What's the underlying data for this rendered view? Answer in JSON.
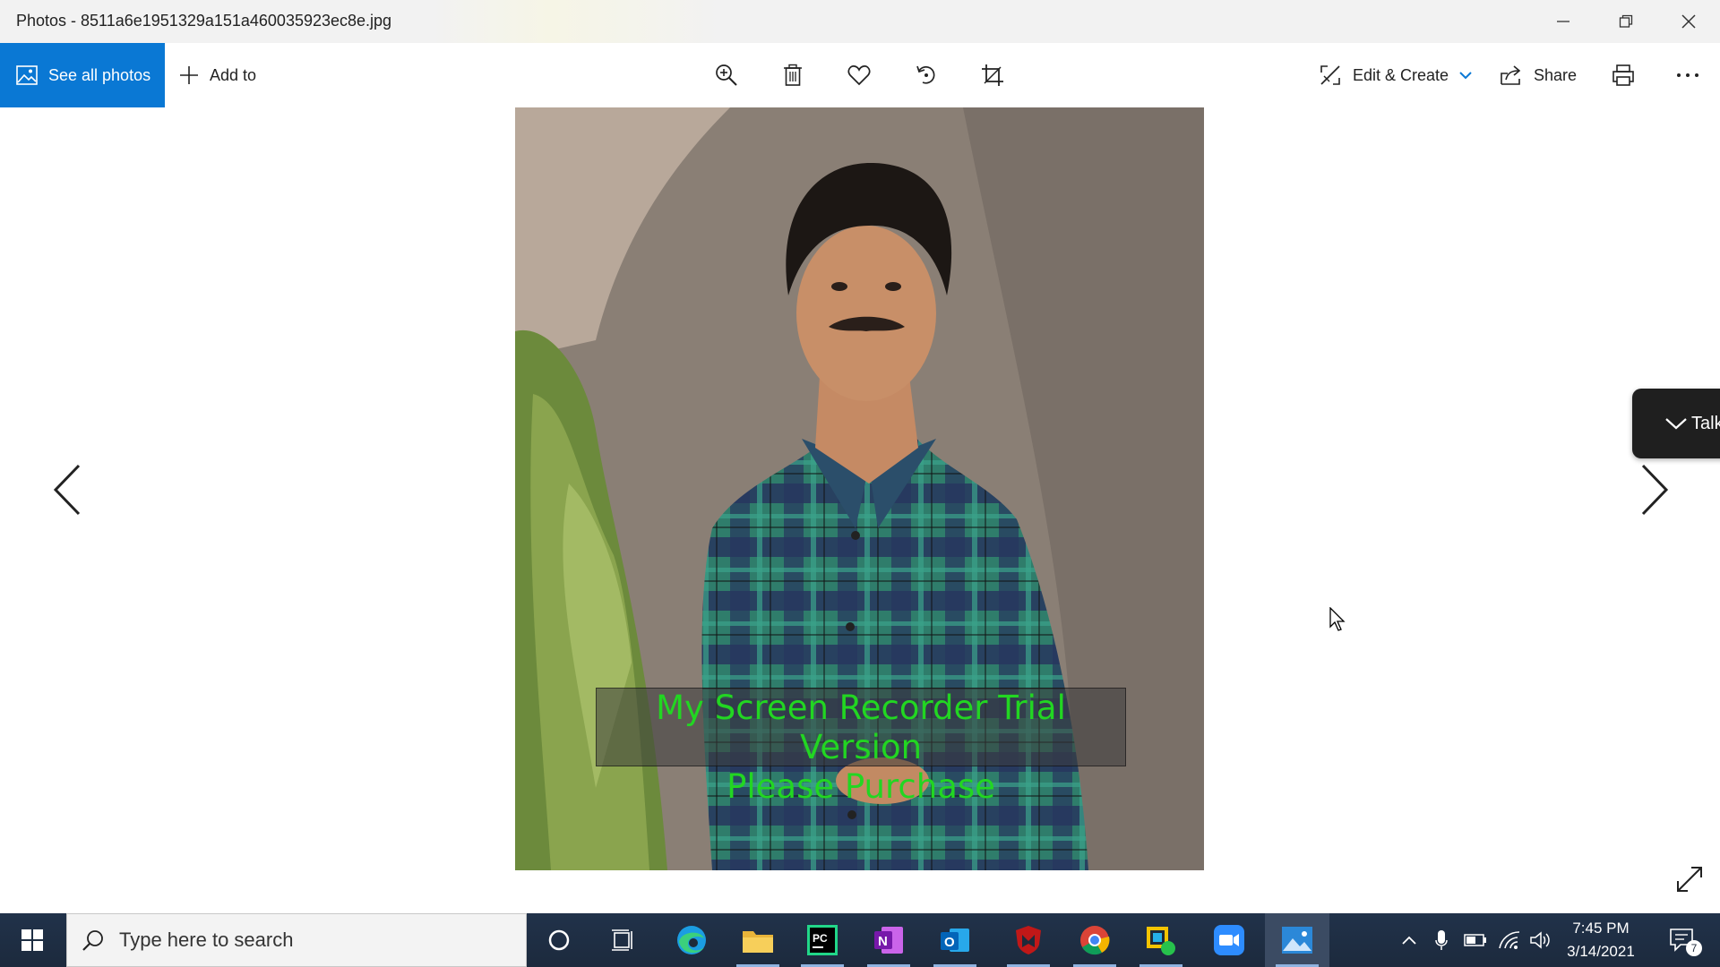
{
  "window": {
    "title": "Photos - 8511a6e1951329a151a460035923ec8e.jpg",
    "controls": [
      "minimize-icon",
      "restore-icon",
      "close-icon"
    ]
  },
  "toolbar": {
    "see_all_label": "See all photos",
    "add_to_label": "Add to",
    "tools": [
      "zoom-icon",
      "delete-icon",
      "favorite-icon",
      "rotate-icon",
      "crop-icon"
    ],
    "edit_create_label": "Edit & Create",
    "share_label": "Share",
    "print_icon": "print-icon",
    "more_icon": "more-icon"
  },
  "viewer": {
    "watermark_line1": "My Screen Recorder Trial Version",
    "watermark_line2": "Please Purchase",
    "talk_label": "Talk"
  },
  "taskbar": {
    "search_placeholder": "Type here to search",
    "apps": [
      "cortana-icon",
      "task-view-icon",
      "edge-icon",
      "file-explorer-icon",
      "pycharm-icon",
      "onenote-icon",
      "outlook-icon",
      "mcafee-icon",
      "chrome-icon",
      "mail-app-icon",
      "zoom-icon",
      "photos-icon"
    ],
    "time": "7:45 PM",
    "date": "3/14/2021",
    "notification_count": "7"
  },
  "colors": {
    "accent": "#0a78d4",
    "taskbar": "#1e2a3a",
    "watermark_text": "#22d622"
  }
}
